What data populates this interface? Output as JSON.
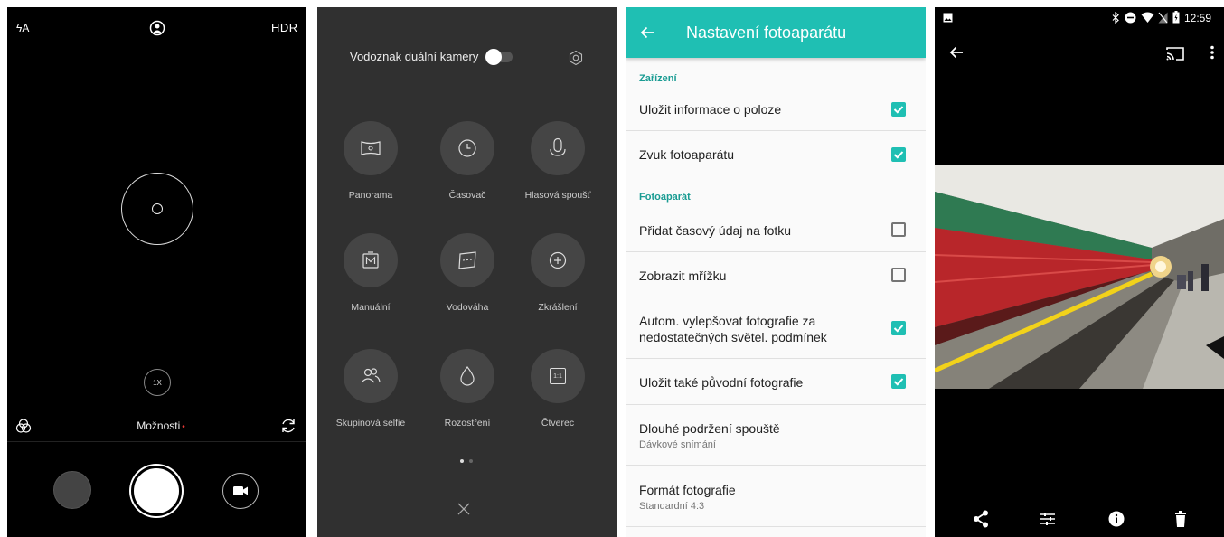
{
  "panel1": {
    "top_left": "ϟA",
    "top_right": "HDR",
    "zoom": "1X",
    "options_label": "Možnosti",
    "options_dot": "•",
    "icons": [
      "flash-auto-icon",
      "portrait-icon",
      "hdr-icon",
      "filters-icon",
      "switch-camera-icon",
      "video-icon"
    ]
  },
  "panel2": {
    "toggle_label": "Vodoznak duální kamery",
    "toggle_on": false,
    "modes": [
      {
        "label": "Panorama",
        "icon": "panorama-icon"
      },
      {
        "label": "Časovač",
        "icon": "timer-icon"
      },
      {
        "label": "Hlasová spoušť",
        "icon": "microphone-icon"
      },
      {
        "label": "Manuální",
        "icon": "manual-icon"
      },
      {
        "label": "Vodováha",
        "icon": "level-icon"
      },
      {
        "label": "Zkrášlení",
        "icon": "beautify-icon"
      },
      {
        "label": "Skupinová selfie",
        "icon": "group-selfie-icon"
      },
      {
        "label": "Rozostření",
        "icon": "blur-drop-icon"
      },
      {
        "label": "Čtverec",
        "icon": "square-icon"
      }
    ],
    "square_glyph": "1:1"
  },
  "panel3": {
    "title": "Nastavení fotoaparátu",
    "accent": "#1fbfb3",
    "sections": [
      {
        "header": "Zařízení"
      },
      {
        "header": "Fotoaparát"
      }
    ],
    "rows": [
      {
        "title": "Uložit informace o poloze",
        "checked": true
      },
      {
        "title": "Zvuk fotoaparátu",
        "checked": true
      },
      {
        "title": "Přidat časový údaj na fotku",
        "checked": false
      },
      {
        "title": "Zobrazit mřížku",
        "checked": false
      },
      {
        "title": "Autom. vylepšovat fotografie za",
        "title2": "nedostatečných světel. podmínek",
        "checked": true
      },
      {
        "title": "Uložit také původní fotografie",
        "checked": true
      },
      {
        "title": "Dlouhé podržení spouště",
        "subtitle": "Dávkové snímání"
      },
      {
        "title": "Formát fotografie",
        "subtitle": "Standardní 4:3"
      }
    ]
  },
  "panel4": {
    "time": "12:59",
    "icons": [
      "gallery-notification-icon",
      "bluetooth-icon",
      "dnd-icon",
      "wifi-icon",
      "no-sim-icon",
      "battery-icon",
      "back-arrow-icon",
      "cast-icon",
      "more-vert-icon",
      "share-icon",
      "edit-adjust-icon",
      "info-icon",
      "delete-icon"
    ]
  }
}
